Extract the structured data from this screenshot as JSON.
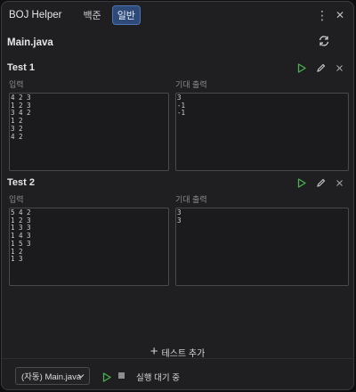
{
  "header": {
    "app_title": "BOJ Helper",
    "tabs": [
      {
        "label": "백준",
        "active": false
      },
      {
        "label": "일반",
        "active": true
      }
    ],
    "more_icon": "more-vertical-icon",
    "close_icon": "close-icon"
  },
  "file": {
    "name": "Main.java",
    "refresh_icon": "refresh-icon"
  },
  "tests": [
    {
      "title": "Test 1",
      "input_label": "입력",
      "expected_label": "기대 출력",
      "input": "4 2 3\n1 2 3\n3 4 2\n1 2\n3 2\n4 2",
      "expected": "3\n-1\n-1"
    },
    {
      "title": "Test 2",
      "input_label": "입력",
      "expected_label": "기대 출력",
      "input": "5 4 2\n1 2 3\n1 3 3\n1 4 3\n1 5 3\n1 2\n1 3",
      "expected": "3\n3"
    }
  ],
  "add_test_label": "테스트 추가",
  "footer": {
    "select_value": "(자동) Main.java",
    "status": "실행 대기 중"
  },
  "colors": {
    "accent_play": "#4caf50",
    "tab_active_bg": "#2e4a78",
    "background": "#1f1f21"
  }
}
